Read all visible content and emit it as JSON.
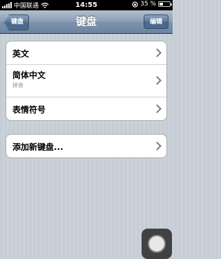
{
  "status": {
    "carrier": "中国联通",
    "time": "14:55",
    "battery": "35 %",
    "battery_level": 0.35
  },
  "nav": {
    "back_label": "键盘",
    "title": "键盘",
    "edit_label": "编辑"
  },
  "keyboards": [
    {
      "label": "英文",
      "sub": ""
    },
    {
      "label": "简体中文",
      "sub": "拼音"
    },
    {
      "label": "表情符号",
      "sub": ""
    }
  ],
  "add_keyboard": {
    "label": "添加新键盘..."
  }
}
